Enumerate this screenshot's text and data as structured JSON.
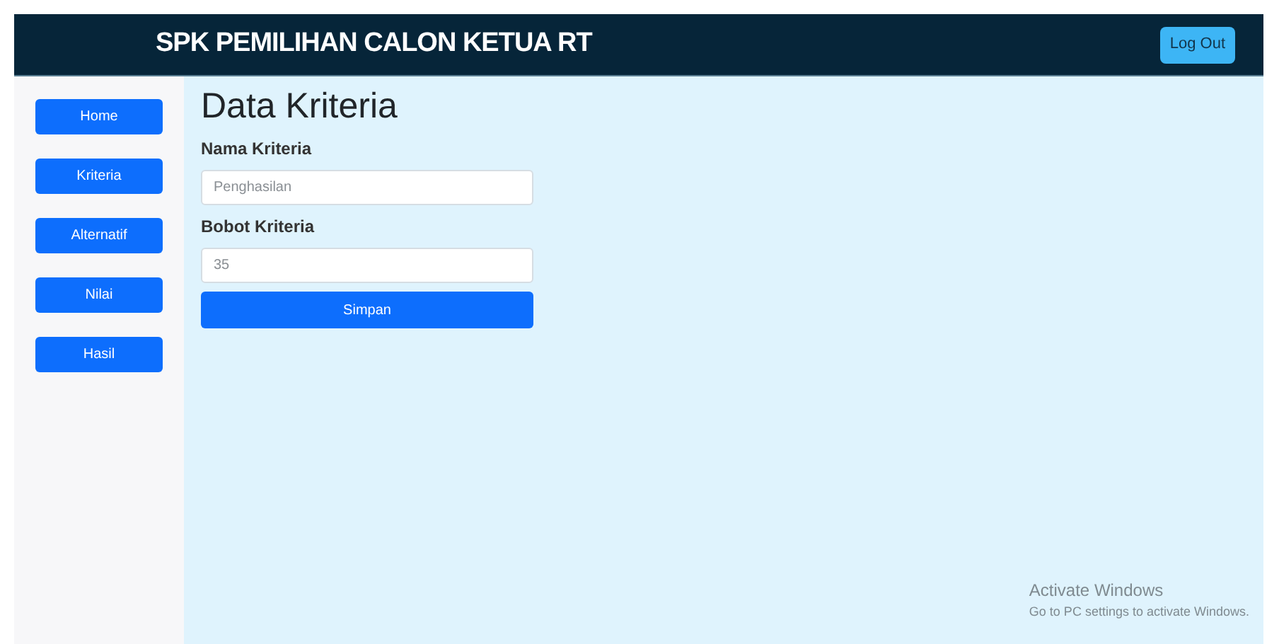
{
  "header": {
    "title": "SPK PEMILIHAN CALON KETUA RT",
    "logout": "Log Out"
  },
  "sidebar": {
    "items": [
      {
        "label": "Home"
      },
      {
        "label": "Kriteria"
      },
      {
        "label": "Alternatif"
      },
      {
        "label": "Nilai"
      },
      {
        "label": "Hasil"
      }
    ]
  },
  "page_title": "Data Kriteria",
  "form": {
    "fields": [
      {
        "label": "Nama Kriteria",
        "placeholder": "Penghasilan"
      },
      {
        "label": "Bobot Kriteria",
        "placeholder": "35"
      }
    ],
    "submit": "Simpan"
  },
  "system_notice": {
    "title": "Activate Windows",
    "text": "Go to PC settings to activate Windows."
  }
}
